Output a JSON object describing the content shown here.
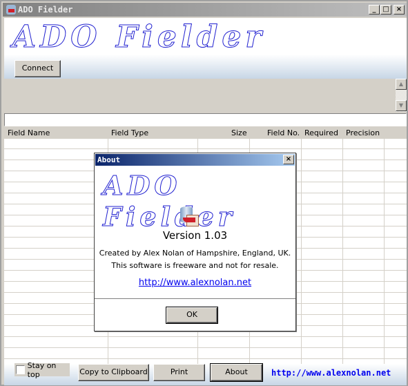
{
  "window": {
    "title": "ADO Fielder",
    "minimize": "_",
    "maximize": "□",
    "close": "×"
  },
  "banner": {
    "logo": "ADO Fielder",
    "connect": "Connect"
  },
  "scroll": {
    "up": "▲",
    "down": "▼"
  },
  "columns": [
    "Field Name",
    "Field Type",
    "Size",
    "Field No.",
    "Required",
    "Precision"
  ],
  "footer": {
    "stay_on_top": "Stay on top",
    "stay_on_top_checked": false,
    "copy": "Copy to Clipboard",
    "print": "Print",
    "about": "About",
    "link": "http://www.alexnolan.net"
  },
  "about": {
    "title": "About",
    "close": "×",
    "logo": "ADO Fielder",
    "icon": "database-export-icon",
    "version": "Version 1.03",
    "line1": "Created by Alex Nolan of Hampshire, England, UK.",
    "line2": "This software is freeware and not for resale.",
    "link": "http://www.alexnolan.net",
    "ok": "OK"
  },
  "colors": {
    "logo": "#2020d0",
    "dialog_title": "#0a246a",
    "link": "#0000ee"
  }
}
